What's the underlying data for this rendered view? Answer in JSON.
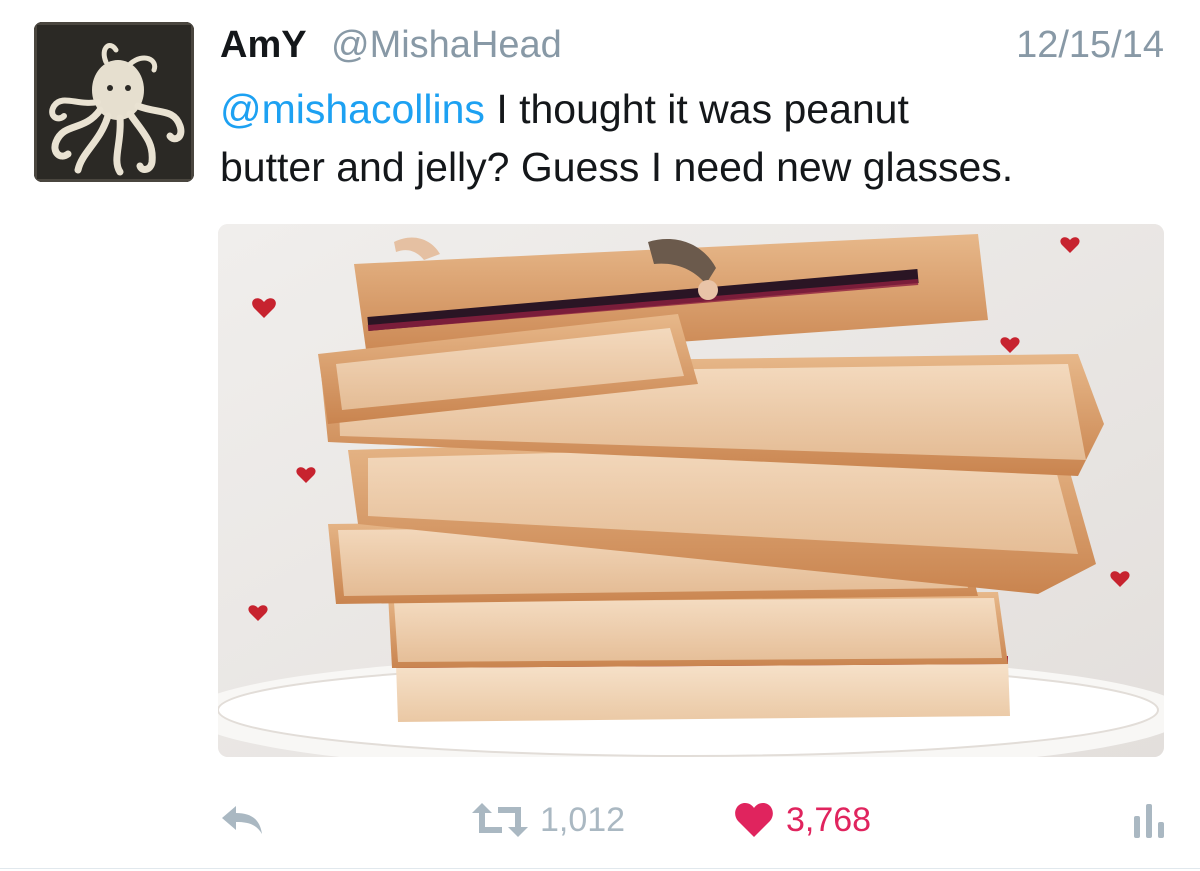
{
  "tweet": {
    "display_name": "AmY",
    "handle": "@MishaHead",
    "date": "12/15/14",
    "mention": "@mishacollins",
    "text_line1_rest": " I thought it was peanut",
    "text_line2": "butter and jelly? Guess I need new glasses."
  },
  "actions": {
    "retweet_count": "1,012",
    "like_count": "3,768"
  },
  "icons": {
    "reply": "reply-arrow-icon",
    "retweet": "retweet-icon",
    "like": "heart-icon",
    "analytics": "bar-chart-icon"
  },
  "colors": {
    "link": "#1da1f2",
    "like": "#e0245e",
    "muted": "#aab8c2"
  }
}
